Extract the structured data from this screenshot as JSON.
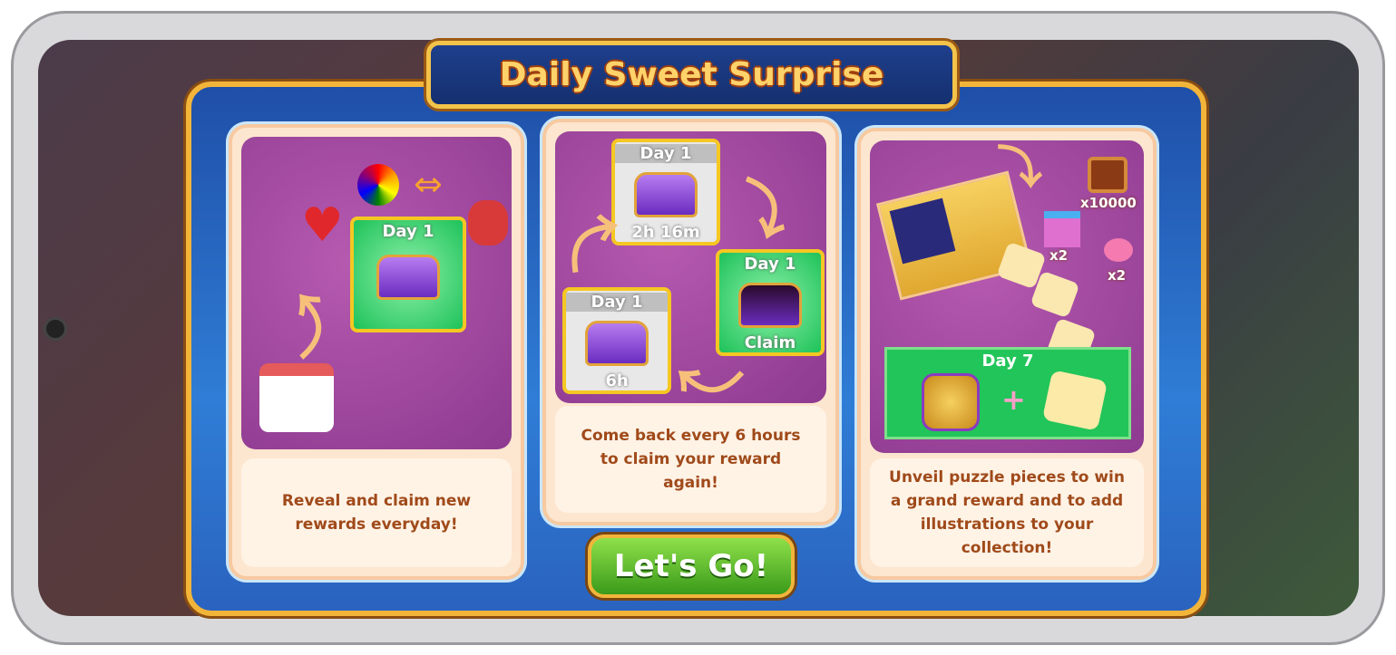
{
  "title": "Daily Sweet Surprise",
  "cards": [
    {
      "description": "Reveal and claim new rewards everyday!",
      "tile_label": "Day 1"
    },
    {
      "description": "Come back every 6 hours to claim your reward again!",
      "tiles": [
        {
          "label": "Day 1",
          "status": "2h 16m"
        },
        {
          "label": "Day 1",
          "status": "Claim"
        },
        {
          "label": "Day 1",
          "status": "6h"
        }
      ]
    },
    {
      "description": "Unveil puzzle pieces to win a grand reward and to add illustrations to your collection!",
      "rewards": {
        "cookie": "x10000",
        "gift": "x2",
        "candy": "x2"
      },
      "grand_label": "Day 7"
    }
  ],
  "button": {
    "label": "Let's Go!"
  },
  "colors": {
    "accent_gold": "#f2b53a",
    "frame_blue": "#2f7dd6",
    "card_purple": "#8d3a90",
    "button_green": "#3a9a1a"
  }
}
